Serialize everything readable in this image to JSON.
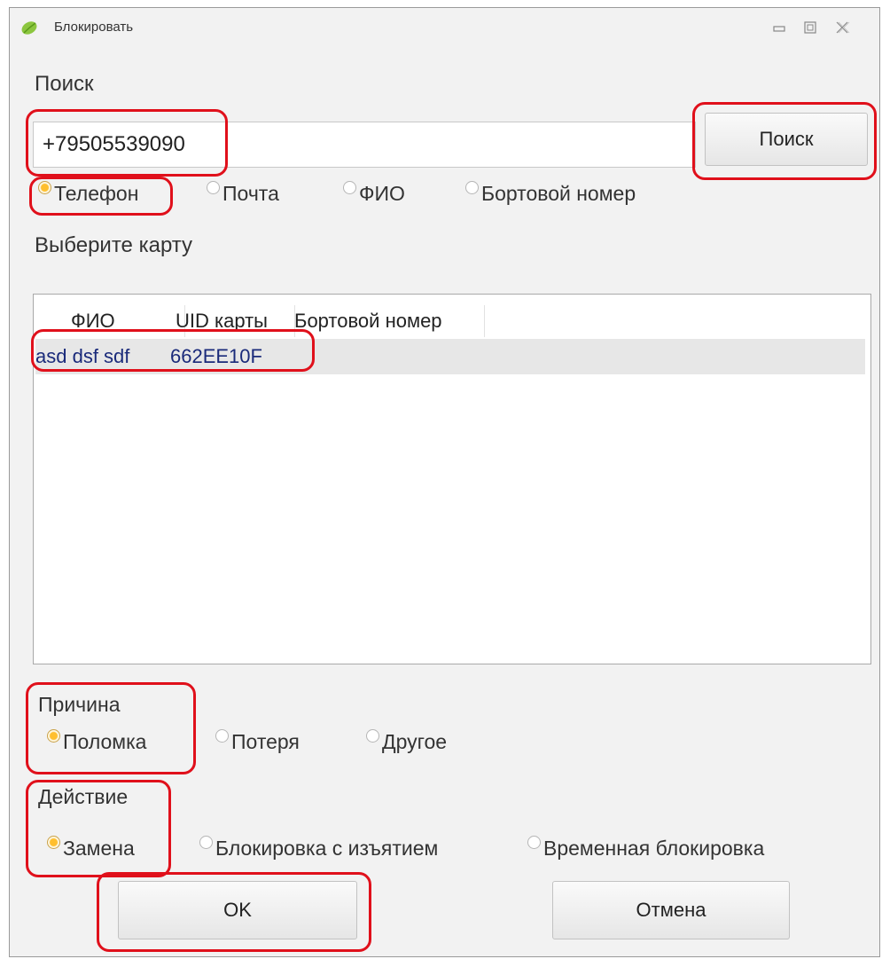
{
  "window": {
    "title": "Блокировать"
  },
  "search": {
    "label": "Поиск",
    "value": "+79505539090",
    "button": "Поиск",
    "options": [
      "Телефон",
      "Почта",
      "ФИО",
      "Бортовой номер"
    ],
    "selected": "Телефон"
  },
  "cards": {
    "label": "Выберите карту",
    "columns": [
      "ФИО",
      "UID карты",
      "Бортовой номер"
    ],
    "rows": [
      {
        "name": "asd dsf sdf",
        "uid": "662EE10F",
        "board": ""
      }
    ]
  },
  "reason": {
    "label": "Причина",
    "options": [
      "Поломка",
      "Потеря",
      "Другое"
    ],
    "selected": "Поломка"
  },
  "action": {
    "label": "Действие",
    "options": [
      "Замена",
      "Блокировка с изъятием",
      "Временная блокировка"
    ],
    "selected": "Замена"
  },
  "buttons": {
    "ok": "OK",
    "cancel": "Отмена"
  },
  "colors": {
    "highlight": "#e0101b",
    "radio_selected": "#ffbf2e",
    "row_text": "#1a2a7a"
  }
}
